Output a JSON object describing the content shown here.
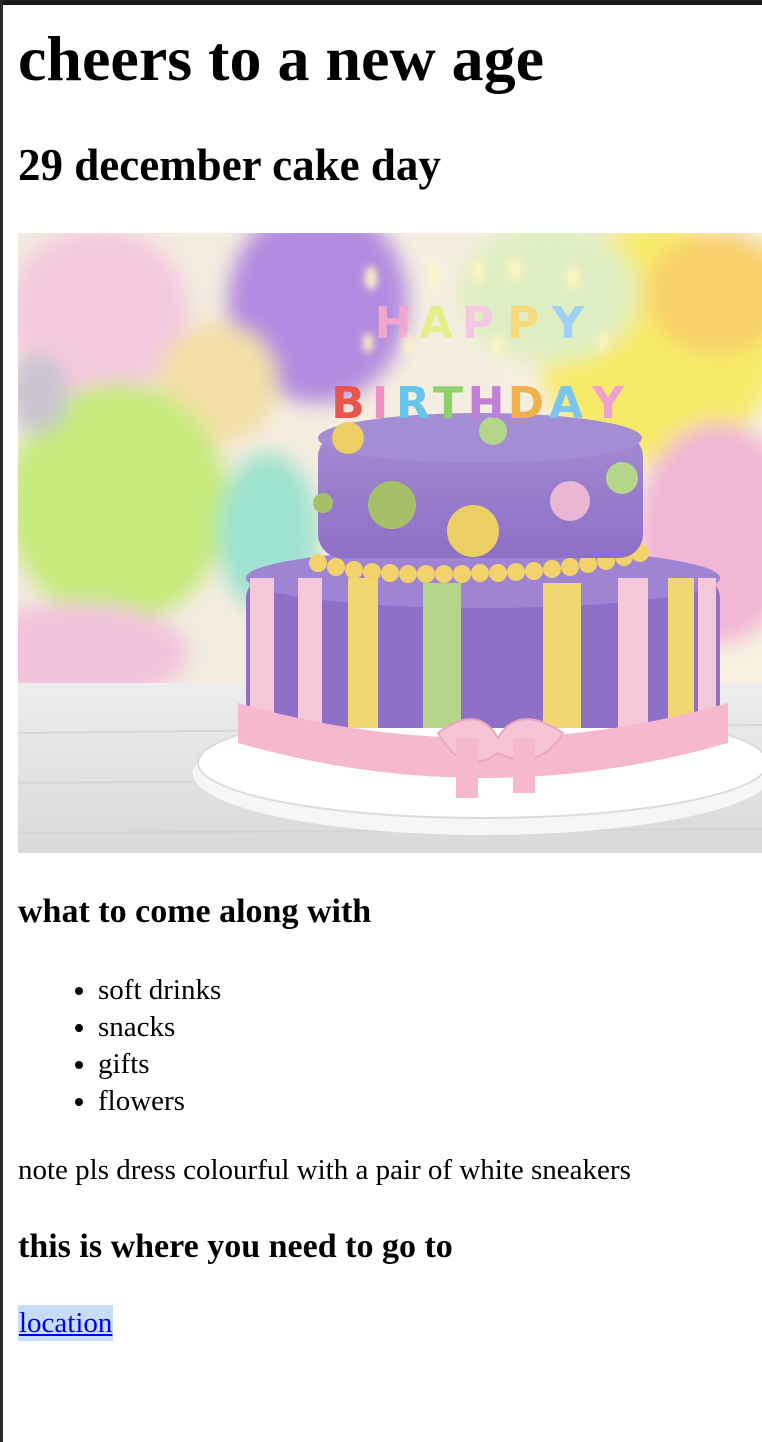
{
  "heading": "cheers to a new age",
  "subheading": "29 december cake day",
  "hero_image": {
    "candle_letters_top": "HAPPY",
    "candle_letters_bottom": "BIRTHDAY"
  },
  "bring": {
    "title": "what to come along with",
    "items": [
      "soft drinks",
      "snacks",
      "gifts",
      "flowers"
    ]
  },
  "note": "note pls dress colourful with a pair of white sneakers",
  "location_section": {
    "title": "this is where you need to go to",
    "link_label": "location"
  }
}
